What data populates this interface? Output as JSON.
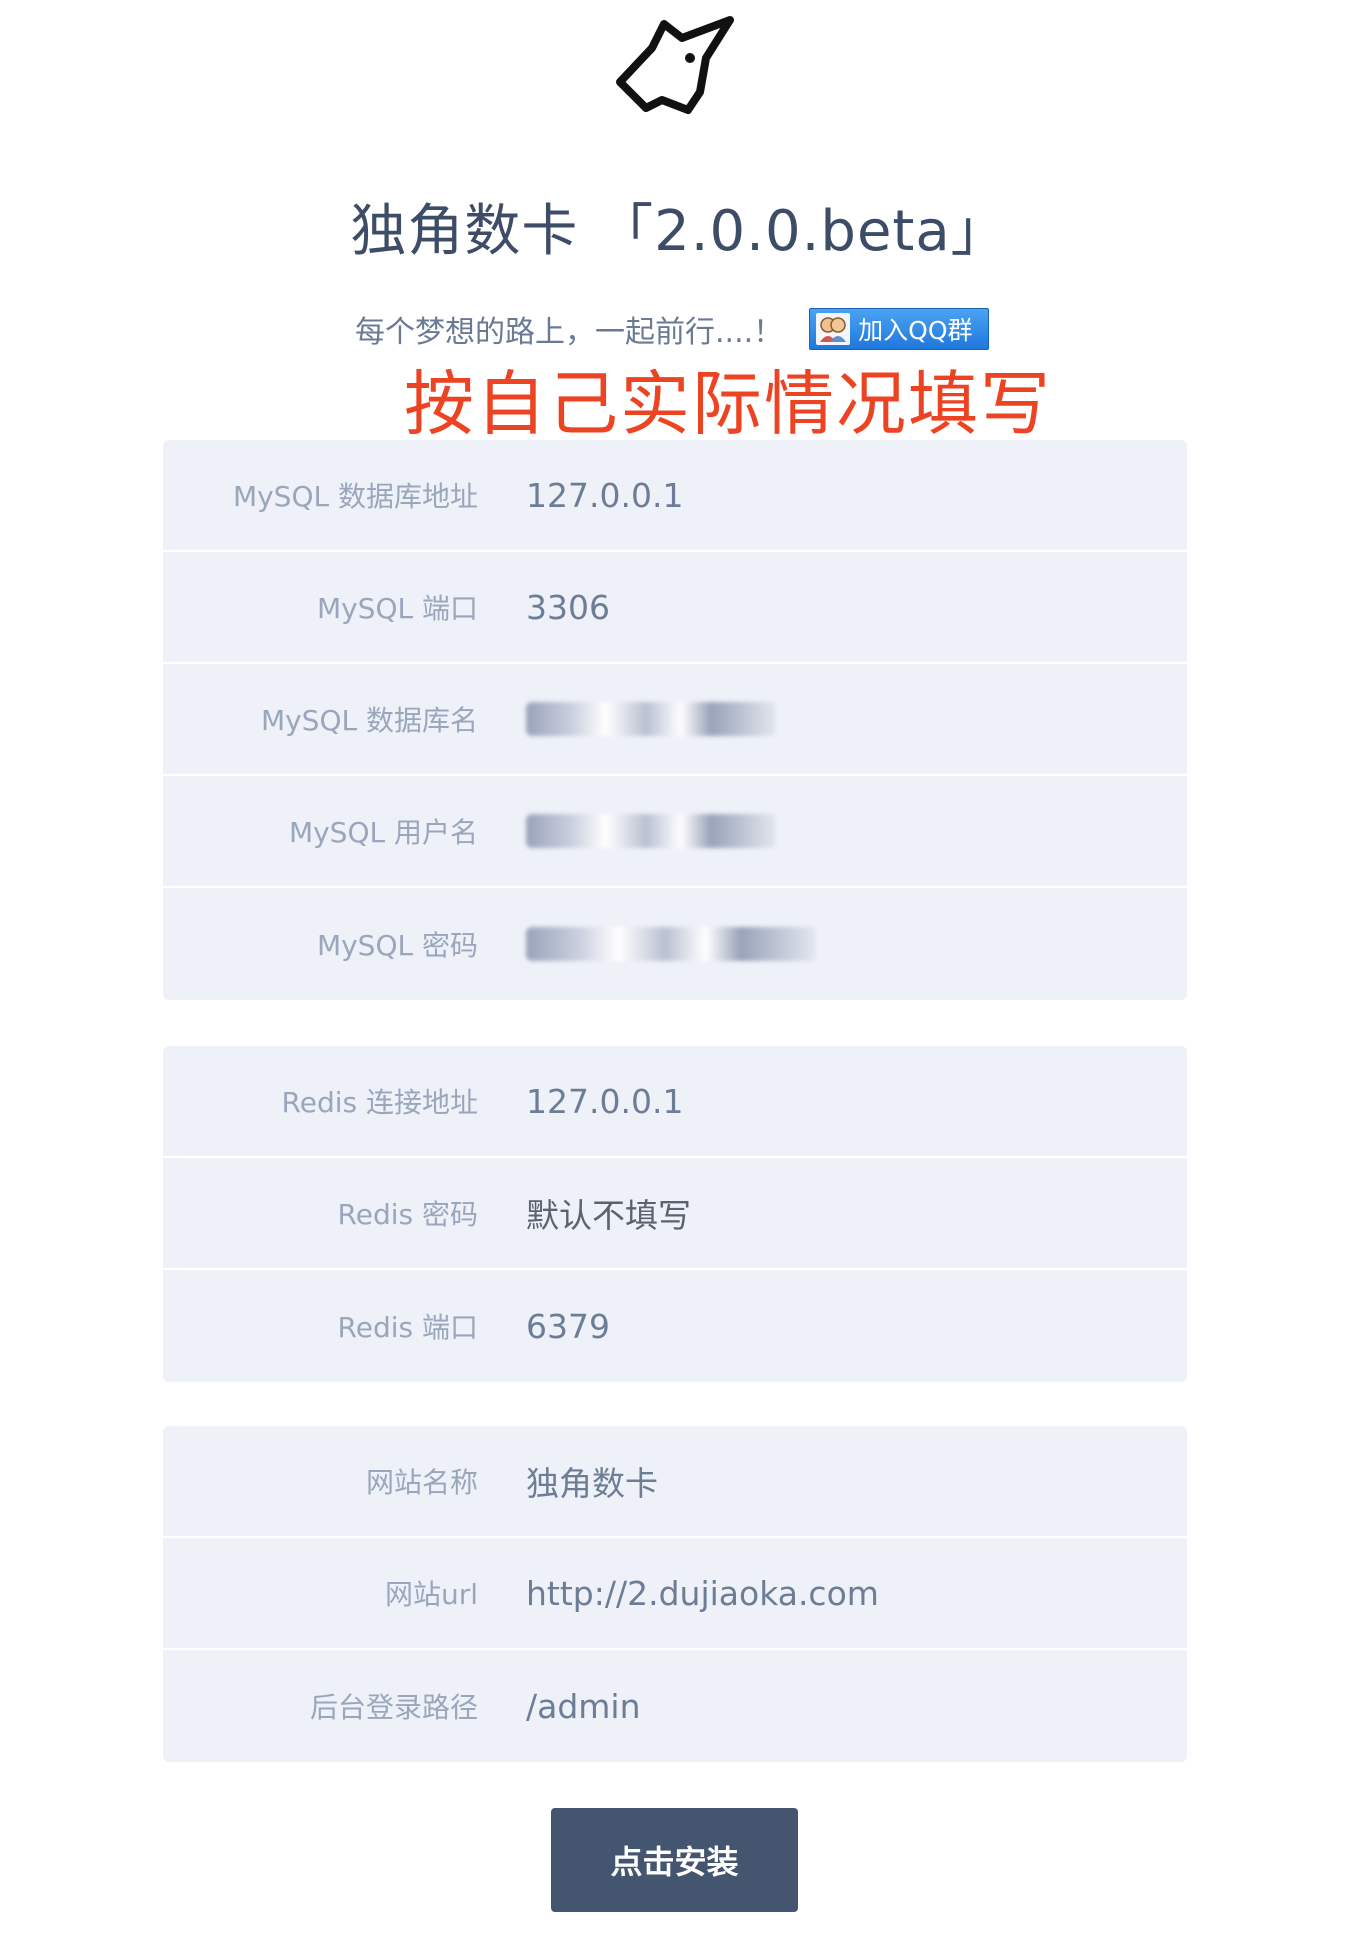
{
  "header": {
    "title": "独角数卡 「2.0.0.beta」",
    "subtitle": "每个梦想的路上，一起前行....！",
    "qq_button": "加入QQ群",
    "note": "按自己实际情况填写"
  },
  "mysql": {
    "host_label": "MySQL 数据库地址",
    "host_value": "127.0.0.1",
    "port_label": "MySQL 端口",
    "port_value": "3306",
    "db_label": "MySQL 数据库名",
    "user_label": "MySQL 用户名",
    "password_label": "MySQL 密码"
  },
  "redis": {
    "host_label": "Redis 连接地址",
    "host_value": "127.0.0.1",
    "password_label": "Redis 密码",
    "password_placeholder": "默认不填写",
    "port_label": "Redis 端口",
    "port_value": "6379"
  },
  "site": {
    "name_label": "网站名称",
    "name_value": "独角数卡",
    "url_label": "网站url",
    "url_value": "http://2.dujiaoka.com",
    "admin_label": "后台登录路径",
    "admin_value": "/admin"
  },
  "actions": {
    "install_label": "点击安装"
  },
  "icons": {
    "logo": "unicorn-icon",
    "qq": "qq-group-icon"
  },
  "colors": {
    "button": "#44556f",
    "note": "#ec4423",
    "panel": "#eef2f8"
  }
}
